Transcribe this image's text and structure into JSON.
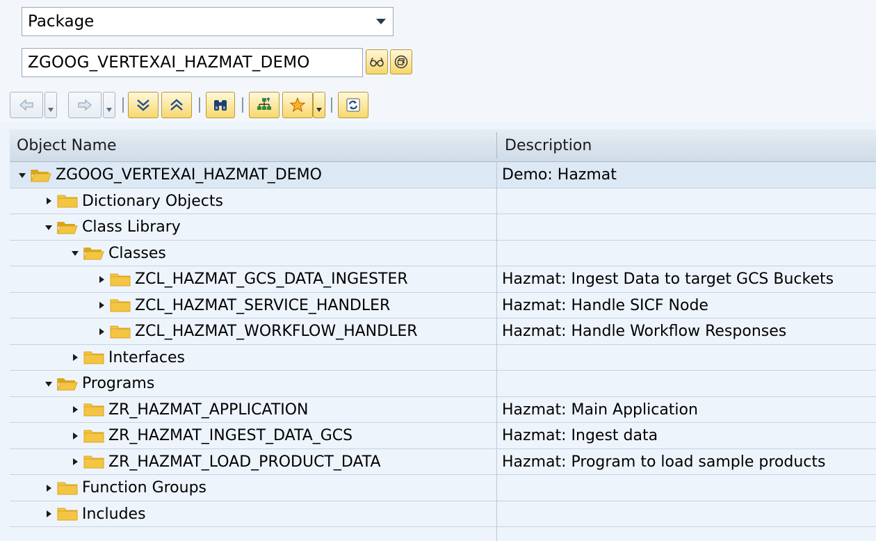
{
  "object_type": {
    "selected": "Package"
  },
  "package_field": {
    "value": "ZGOOG_VERTEXAI_HAZMAT_DEMO"
  },
  "toolbar": {
    "buttons": [
      "arrow-left-icon",
      "arrow-right-icon",
      "expand-all-icon",
      "collapse-all-icon",
      "binoculars-icon",
      "hierarchy-icon",
      "star-icon",
      "refresh-icon"
    ]
  },
  "tree": {
    "columns": [
      "Object Name",
      "Description"
    ],
    "rows": [
      {
        "level": 0,
        "expanded": true,
        "name": "ZGOOG_VERTEXAI_HAZMAT_DEMO",
        "desc": "Demo: Hazmat"
      },
      {
        "level": 1,
        "expanded": false,
        "name": "Dictionary Objects",
        "desc": ""
      },
      {
        "level": 1,
        "expanded": true,
        "name": "Class Library",
        "desc": ""
      },
      {
        "level": 2,
        "expanded": true,
        "name": "Classes",
        "desc": ""
      },
      {
        "level": 3,
        "expanded": false,
        "name": "ZCL_HAZMAT_GCS_DATA_INGESTER",
        "desc": "Hazmat: Ingest Data to target GCS Buckets"
      },
      {
        "level": 3,
        "expanded": false,
        "name": "ZCL_HAZMAT_SERVICE_HANDLER",
        "desc": "Hazmat: Handle SICF Node"
      },
      {
        "level": 3,
        "expanded": false,
        "name": "ZCL_HAZMAT_WORKFLOW_HANDLER",
        "desc": "Hazmat: Handle Workflow Responses"
      },
      {
        "level": 2,
        "expanded": false,
        "name": "Interfaces",
        "desc": ""
      },
      {
        "level": 1,
        "expanded": true,
        "name": "Programs",
        "desc": ""
      },
      {
        "level": 2,
        "expanded": false,
        "name": "ZR_HAZMAT_APPLICATION",
        "desc": "Hazmat: Main Application"
      },
      {
        "level": 2,
        "expanded": false,
        "name": "ZR_HAZMAT_INGEST_DATA_GCS",
        "desc": "Hazmat: Ingest data"
      },
      {
        "level": 2,
        "expanded": false,
        "name": "ZR_HAZMAT_LOAD_PRODUCT_DATA",
        "desc": "Hazmat: Program to load sample products"
      },
      {
        "level": 1,
        "expanded": false,
        "name": "Function Groups",
        "desc": ""
      },
      {
        "level": 1,
        "expanded": false,
        "name": "Includes",
        "desc": ""
      }
    ]
  },
  "colors": {
    "folder": "#f4c542",
    "folder_dark": "#d9a521",
    "selected_row": "#dce8f4",
    "button_gold": "#f7d86d"
  }
}
